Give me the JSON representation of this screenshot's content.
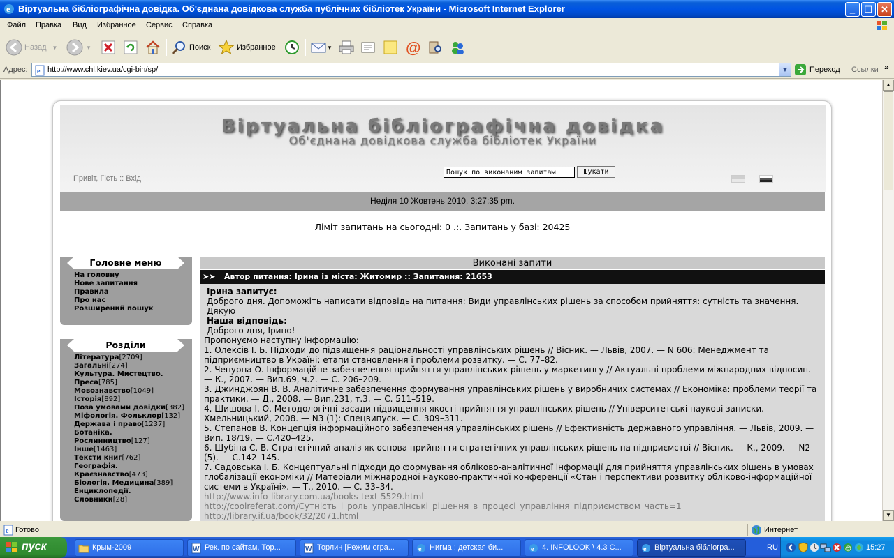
{
  "window": {
    "title": "Віртуальна бібліографічна довідка. Об'єднана довідкова служба публічних бібліотек України - Microsoft Internet Explorer"
  },
  "menu": [
    "Файл",
    "Правка",
    "Вид",
    "Избранное",
    "Сервис",
    "Справка"
  ],
  "toolbar": {
    "back": "Назад",
    "search": "Поиск",
    "favorites": "Избранное"
  },
  "address": {
    "label": "Адрес:",
    "url": "http://www.chl.kiev.ua/cgi-bin/sp/",
    "go": "Переход",
    "links": "Ссылки"
  },
  "site": {
    "title": "Віртуальна бібліографічна довідка",
    "subtitle": "Об'єднана довідкова служба бібліотек України",
    "greeting": "Привіт, Гість :: Вхід",
    "search_value": "Пошук по виконаним запитам",
    "search_button": "Шукати",
    "date": "Неділя 10 Жовтень 2010, 3:27:35 pm.",
    "limit": "Ліміт запитань на сьогодні: 0 .:. Запитань у базі: 20425"
  },
  "main_menu": {
    "title": "Головне меню",
    "items": [
      "На головну",
      "Нове запитання",
      "Правила",
      "Про нас",
      "Розширений пошук"
    ]
  },
  "sections": {
    "title": "Розділи",
    "items": [
      {
        "name": "Література",
        "count": "[2709]"
      },
      {
        "name": "Загальні",
        "count": "[274]"
      },
      {
        "name": "Культура. Мистецтво. Преса",
        "count": "[785]"
      },
      {
        "name": "Мовознавство",
        "count": "[1049]"
      },
      {
        "name": "Історія",
        "count": "[892]"
      },
      {
        "name": "Поза умовами довідки",
        "count": "[382]"
      },
      {
        "name": "Міфологія. Фольклор",
        "count": "[132]"
      },
      {
        "name": "Держава і право",
        "count": "[1237]"
      },
      {
        "name": "Ботаніка. Рослинництво",
        "count": "[127]"
      },
      {
        "name": "Інше",
        "count": "[1463]"
      },
      {
        "name": "Тексти книг",
        "count": "[762]"
      },
      {
        "name": "Географія. Краєзнавство",
        "count": "[473]"
      },
      {
        "name": "Біологія. Медицина",
        "count": "[389]"
      },
      {
        "name": "Енциклопедії. Словники",
        "count": "[28]"
      }
    ]
  },
  "content": {
    "heading": "Виконані запити",
    "author_bar": "Автор питання: Ірина із міста: Житомир :: Запитання: 21653",
    "asks_label": "Ірина запитує:",
    "question": "Доброго дня. Допоможіть написати відповідь на питання: Види управлінських рішень за способом прийняття: сутність та значення. Дякую",
    "answer_label": "Наша відповідь:",
    "greeting": "Доброго дня, Ірино!",
    "intro": "Пропонуємо наступну інформацію:",
    "refs": [
      "1. Олексів І. Б. Підходи до підвищення раціональності управлінських рішень // Вісник. — Львів, 2007. — N 606: Менеджмент та підприємництво в Україні: етапи становлення і проблеми розвитку. — С. 77–82.",
      "2. Чепурна О. Інформаційне забезпечення прийняття управлінських рішень у маркетингу // Актуальні проблеми міжнародних відносин. — К., 2007. — Вип.69, ч.2. — С. 206–209.",
      "3. Джинджоян В. В. Аналітичне забезпечення формування управлінських рішень у виробничих системах // Економіка: проблеми теорії та практики. — Д., 2008. — Вип.231, т.3. — С. 511–519.",
      "4. Шишова І. О. Методологічні засади підвищення якості прийняття управлінських рішень // Університетські наукові записки. — Хмельницький, 2008. — N3 (1): Спецвипуск. — С. 309–311.",
      "5. Степанов В. Концепція інформаційного забезпечення управлінських рішень // Ефективність державного управління. — Львів, 2009. — Вип. 18/19. — С.420–425.",
      "6. Шубіна С. В. Стратегічний аналіз як основа прийняття стратегічних управлінських рішень на підприємстві // Вісник. — К., 2009. — N2 (5). — С.142–145.",
      "7. Садовська І. Б. Концептуальні підходи до формування обліково-аналітичної інформації для прийняття управлінських рішень в умовах глобалізації економіки // Матеріали міжнародної науково-практичної конференції «Стан і перспективи розвитку обліково-інформаційної системи в Україні». — Т., 2010. — С. 33–34."
    ],
    "links": [
      "http://www.info-library.com.ua/books-text-5529.html",
      "http://coolreferat.com/Сутність_і_роль_управлінські_рішення_в_процесі_управління_підприємством_часть=1",
      "http://library.if.ua/book/32/2071.html"
    ]
  },
  "status": {
    "text": "Готово",
    "zone": "Интернет"
  },
  "taskbar": {
    "start": "пуск",
    "tasks": [
      "Крым-2009",
      "Рек. по сайтам, Тор...",
      "Торлин [Режим огра...",
      "Нигма : детская би...",
      "4. INFOLOOK \\ 4.3 С...",
      "Віртуальна бібліогра..."
    ],
    "lang": "RU",
    "clock": "15:27"
  }
}
